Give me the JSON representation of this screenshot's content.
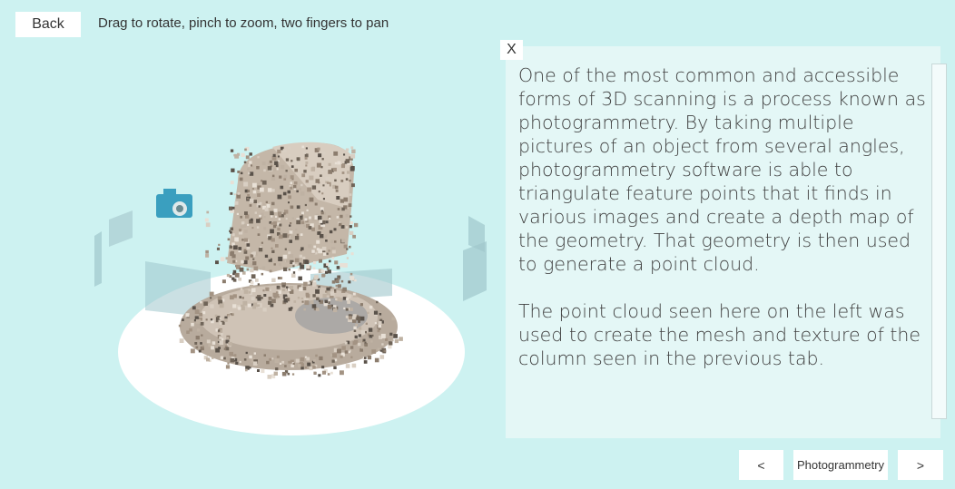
{
  "header": {
    "back_label": "Back",
    "hint_text": "Drag to rotate, pinch to zoom, two fingers to pan"
  },
  "info_panel": {
    "close_label": "X",
    "paragraphs": [
      "One of the most common and accessible forms of 3D scanning is a process known as photogrammetry. By taking multiple pictures of an object from several angles, photogrammetry software is able to triangulate feature points that it finds in various images and create a depth map of the geometry. That geometry is then used to generate a point cloud.",
      "The point cloud seen here on the left was used to create the mesh and texture of the column seen in the previous tab."
    ]
  },
  "navigation": {
    "prev_label": "<",
    "current_tab": "Photogrammetry",
    "next_label": ">"
  },
  "colors": {
    "background": "#cdf2f1",
    "panel": "#e4f7f6",
    "button": "#ffffff",
    "camera": "#3a9fbf"
  },
  "icons": {
    "camera": "camera-icon"
  }
}
